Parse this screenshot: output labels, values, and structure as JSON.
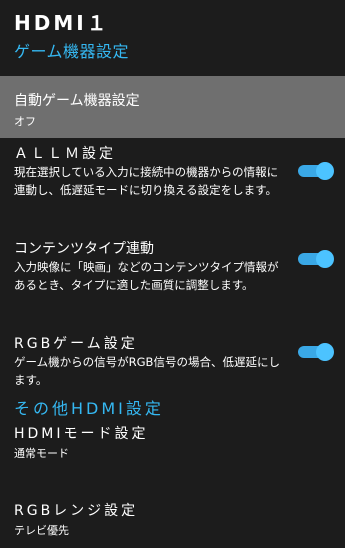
{
  "header": {
    "input_name": "HDMI１",
    "section_title": "ゲーム機器設定"
  },
  "items": [
    {
      "title": "自動ゲーム機器設定",
      "value": "オフ"
    },
    {
      "title": "ＡＬＬＭ設定",
      "description": "現在選択している入力に接続中の機器からの情報に連動し、低遅延モードに切り換える設定をします。",
      "toggle_on": true
    },
    {
      "title": "コンテンツタイプ連動",
      "description": "入力映像に「映画」などのコンテンツタイプ情報があるとき、タイプに適した画質に調整します。",
      "toggle_on": true
    },
    {
      "title": "RGBゲーム設定",
      "description": "ゲーム機からの信号がRGB信号の場合、低遅延にします。",
      "toggle_on": true
    }
  ],
  "other_section": {
    "title": "その他HDMI設定",
    "items": [
      {
        "title": "HDMIモード設定",
        "value": "通常モード"
      },
      {
        "title": "RGBレンジ設定",
        "value": "テレビ優先"
      }
    ]
  },
  "colors": {
    "background": "#1c1c1c",
    "accent": "#35b8f2",
    "toggle_track_on": "#3aa8e6",
    "toggle_knob_on": "#4cc3ff",
    "highlight": "#6f6f6f"
  }
}
